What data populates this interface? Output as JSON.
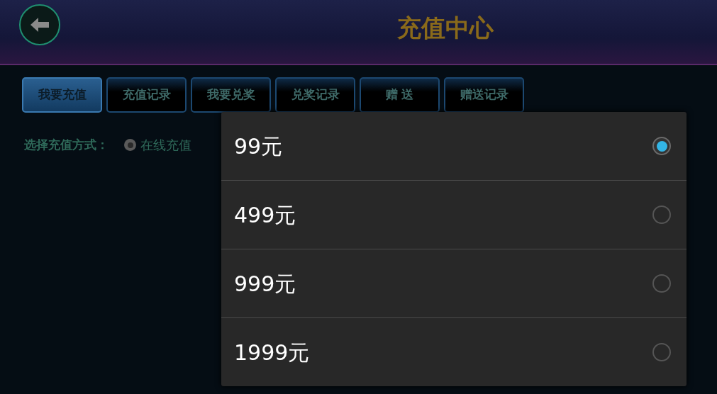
{
  "header": {
    "title": "充值中心"
  },
  "tabs": [
    {
      "label": "我要充值",
      "selected": true
    },
    {
      "label": "充值记录",
      "selected": false
    },
    {
      "label": "我要兑奖",
      "selected": false
    },
    {
      "label": "兑奖记录",
      "selected": false
    },
    {
      "label": "赠 送",
      "selected": false
    },
    {
      "label": "赠送记录",
      "selected": false
    }
  ],
  "payment_method": {
    "label": "选择充值方式：",
    "options": [
      {
        "label": "在线充值",
        "selected": true
      }
    ]
  },
  "amount_dialog": {
    "options": [
      {
        "label": "99元",
        "selected": true
      },
      {
        "label": "499元",
        "selected": false
      },
      {
        "label": "999元",
        "selected": false
      },
      {
        "label": "1999元",
        "selected": false
      }
    ]
  }
}
